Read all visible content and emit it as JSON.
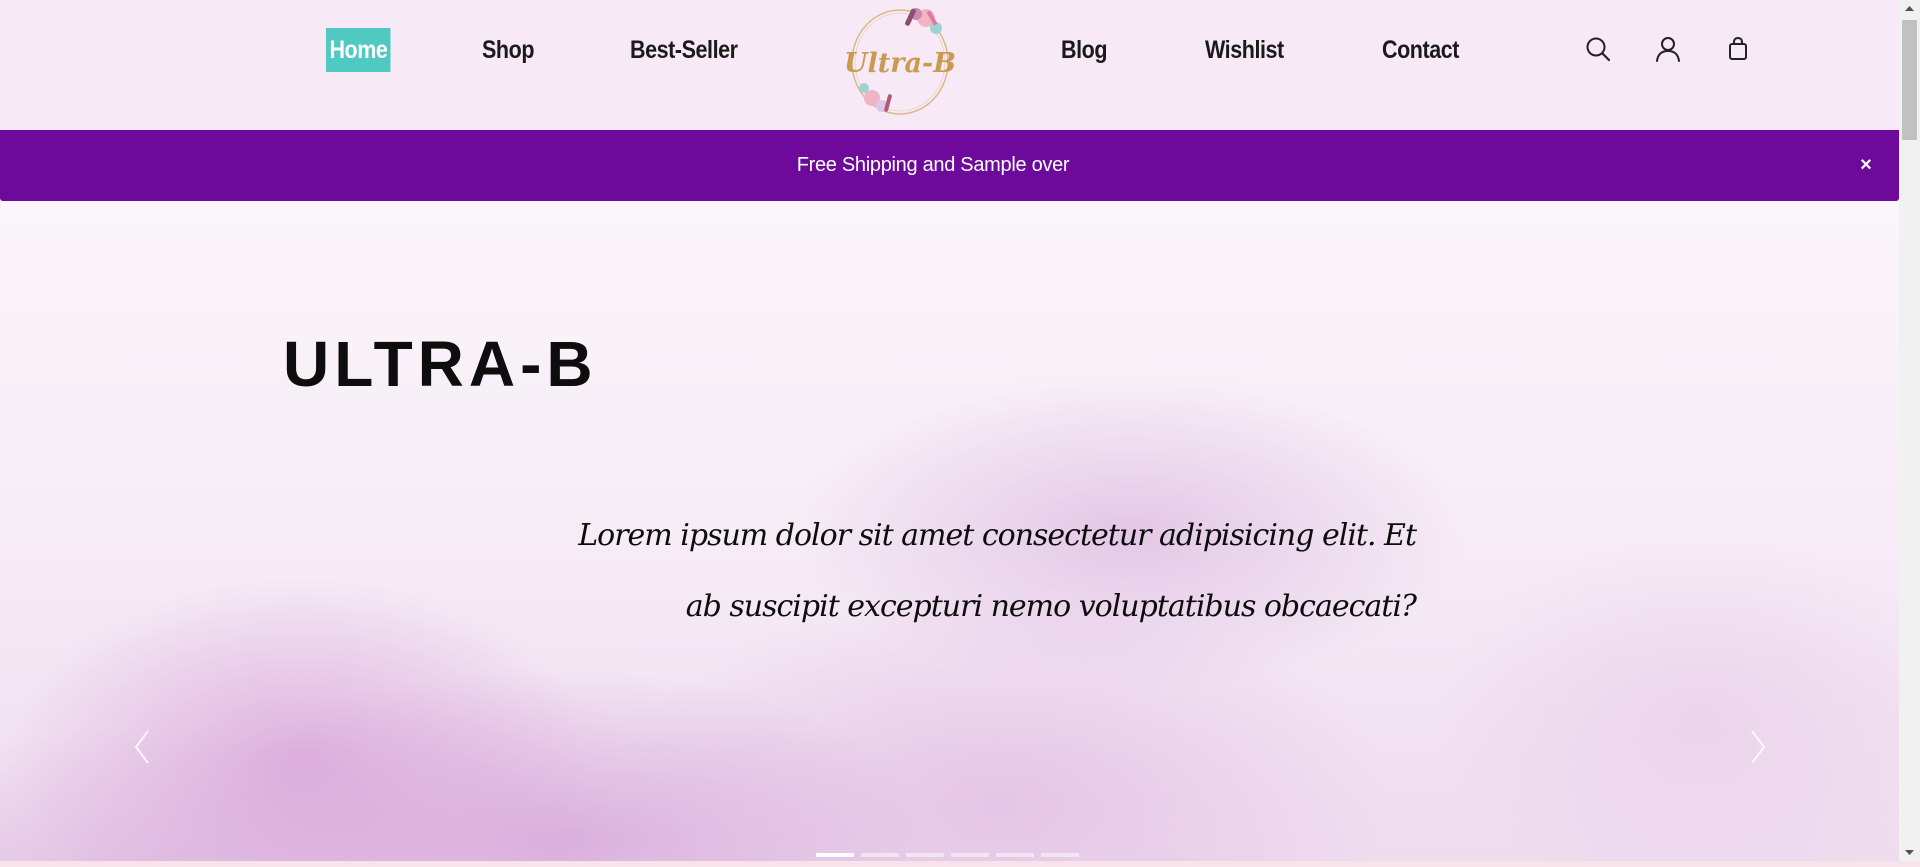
{
  "nav": {
    "home": "Home",
    "shop": "Shop",
    "best_seller": "Best-Seller",
    "blog": "Blog",
    "wishlist": "Wishlist",
    "contact": "Contact",
    "icons": [
      "search-icon",
      "user-icon",
      "shopping-bag-icon"
    ]
  },
  "logo": {
    "text": "Ultra-B"
  },
  "announcement": {
    "text": "Free Shipping and Sample over",
    "close": "×"
  },
  "hero": {
    "title": "ULTRA-B",
    "text": "Lorem ipsum dolor sit amet consectetur adipisicing elit. Et ab suscipit excepturi nemo voluptatibus obcaecati?",
    "slide_count": 6,
    "active_slide": 1
  },
  "colors": {
    "header_bg": "#f8e9f7",
    "active_nav_bg": "#4fc9c2",
    "announcement_bg": "#6e0a9b",
    "text": "#1a1a1a"
  }
}
